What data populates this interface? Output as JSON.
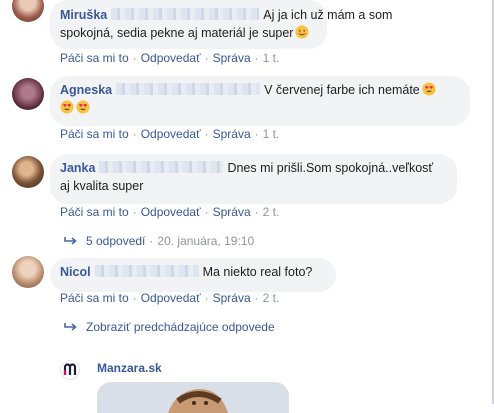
{
  "comments": [
    {
      "author": "Miruška",
      "text_line1": "Aj ja ich už mám a som",
      "text_line2": "spokojná, sedia pekne aj materiál je super",
      "like": "Páči sa mi to",
      "reply": "Odpovedať",
      "message": "Správa",
      "time": "1 t."
    },
    {
      "author": "Agneska",
      "text_line1": "V červenej farbe ich nemáte",
      "like": "Páči sa mi to",
      "reply": "Odpovedať",
      "message": "Správa",
      "time": "1 t."
    },
    {
      "author": "Janka",
      "text_line1": "Dnes mi prišli.Som spokojná..veľkosť",
      "text_line2": "aj kvalita super",
      "like": "Páči sa mi to",
      "reply": "Odpovedať",
      "message": "Správa",
      "time": "2 t."
    },
    {
      "author": "Nicol",
      "text_line1": "Ma niekto real foto?",
      "like": "Páči sa mi to",
      "reply": "Odpovedať",
      "message": "Správa",
      "time": "2 t."
    }
  ],
  "replies_link": {
    "label": "5 odpovedí",
    "date": "20. januára, 19:10"
  },
  "previous_replies": "Zobraziť predchádzajúce odpovede",
  "preview": {
    "name": "Manzara.sk"
  },
  "icons": {
    "reply_arrow": "reply-arrow-icon",
    "emoji_smile": "smiling-face-icon",
    "emoji_hearteyes": "heart-eyes-icon"
  }
}
